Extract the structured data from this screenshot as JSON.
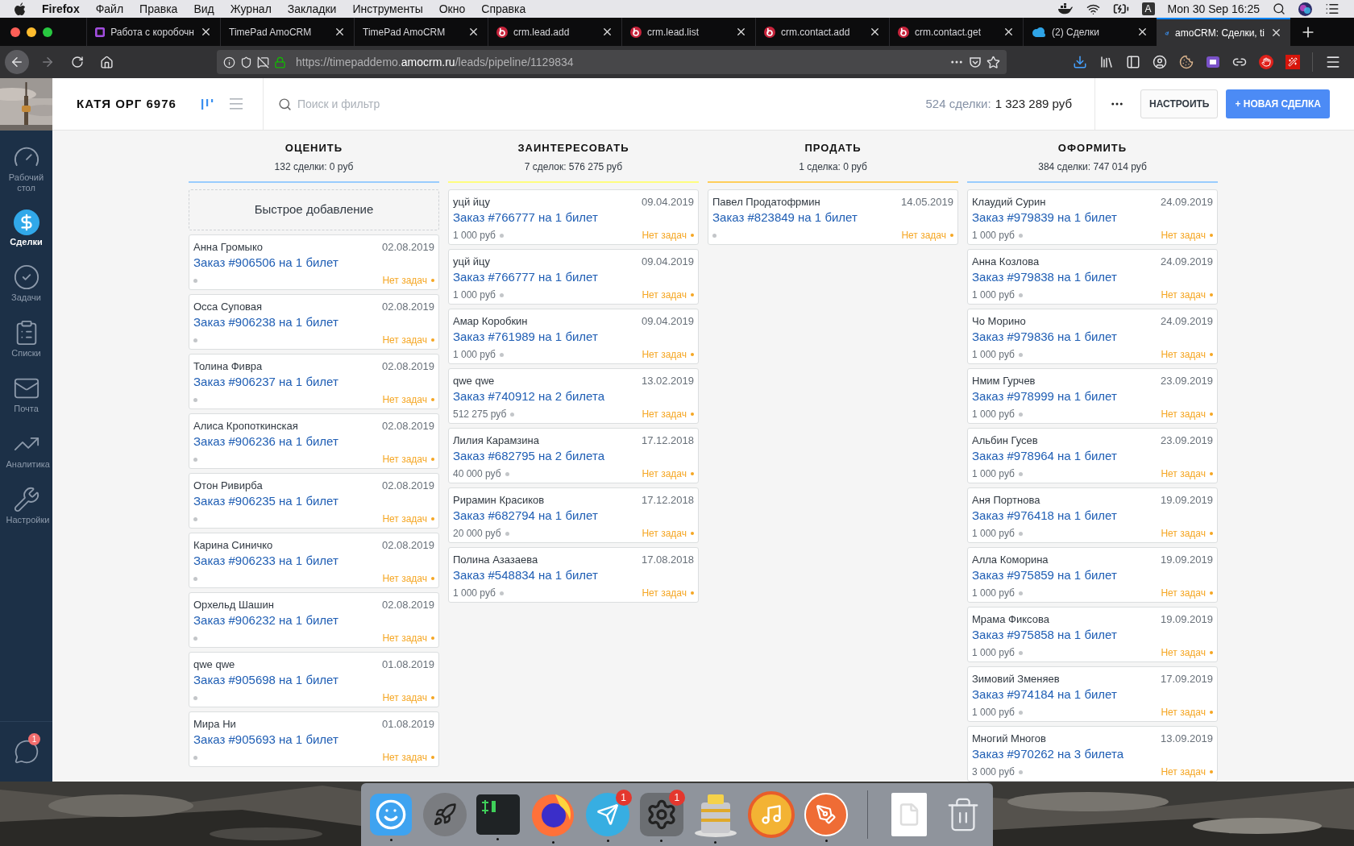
{
  "menu_bar": {
    "app": "Firefox",
    "items": [
      "Файл",
      "Правка",
      "Вид",
      "Журнал",
      "Закладки",
      "Инструменты",
      "Окно",
      "Справка"
    ],
    "input_source": "A",
    "clock": "Mon 30 Sep 16:25"
  },
  "tabs": [
    {
      "title": "Работа с коробочн",
      "kind": "youtrack",
      "selected": false
    },
    {
      "title": "TimePad AmoCRM",
      "kind": "plain",
      "selected": false
    },
    {
      "title": "TimePad AmoCRM",
      "kind": "plain",
      "selected": false
    },
    {
      "title": "crm.lead.add",
      "kind": "bitrix",
      "selected": false
    },
    {
      "title": "crm.lead.list",
      "kind": "bitrix",
      "selected": false
    },
    {
      "title": "crm.contact.add",
      "kind": "bitrix",
      "selected": false
    },
    {
      "title": "crm.contact.get",
      "kind": "bitrix",
      "selected": false
    },
    {
      "title": "(2) Сделки",
      "kind": "b24",
      "selected": false
    },
    {
      "title": "amoCRM: Сделки, ti",
      "kind": "amo",
      "selected": true
    }
  ],
  "address_bar": {
    "url": "https://timepaddemo.**amocrm.ru**/leads/pipeline/1129834"
  },
  "sidebar": {
    "items": [
      {
        "label": "Рабочий стол",
        "kind": "dashboard",
        "selected": false
      },
      {
        "label": "Сделки",
        "kind": "deals",
        "selected": true
      },
      {
        "label": "Задачи",
        "kind": "tasks",
        "selected": false
      },
      {
        "label": "Списки",
        "kind": "lists",
        "selected": false
      },
      {
        "label": "Почта",
        "kind": "mail",
        "selected": false
      },
      {
        "label": "Аналитика",
        "kind": "analytics",
        "selected": false
      },
      {
        "label": "Настройки",
        "kind": "settings",
        "selected": false
      }
    ],
    "chat_badge": "1"
  },
  "header": {
    "title": "КАТЯ ОРГ 6976",
    "views": [
      {
        "kind": "pipeline",
        "selected": true
      },
      {
        "kind": "list",
        "selected": false
      }
    ],
    "search": {
      "placeholder": "Поиск и фильтр"
    },
    "summary_count": "524 сделки:",
    "summary_total": "1 323 289 руб",
    "buttons": [
      {
        "label": "НАСТРОИТЬ",
        "kind": "secondary"
      },
      {
        "label": "+ НОВАЯ СДЕЛКА",
        "kind": "primary"
      }
    ]
  },
  "columns": [
    {
      "title": "ОЦЕНИТЬ",
      "summary": "132 сделки: 0 руб",
      "color": "#99ccfd",
      "quick_add": "Быстрое добавление",
      "cards": [
        {
          "contact": "Анна Громыко",
          "date": "02.08.2019",
          "title": "Заказ #906506 на 1 билет",
          "task": "Нет задач"
        },
        {
          "contact": "Осса Суповая",
          "date": "02.08.2019",
          "title": "Заказ #906238 на 1 билет",
          "task": "Нет задач"
        },
        {
          "contact": "Толина Фивра",
          "date": "02.08.2019",
          "title": "Заказ #906237 на 1 билет",
          "task": "Нет задач"
        },
        {
          "contact": "Алиса Кропоткинская",
          "date": "02.08.2019",
          "title": "Заказ #906236 на 1 билет",
          "task": "Нет задач"
        },
        {
          "contact": "Отон Ривирба",
          "date": "02.08.2019",
          "title": "Заказ #906235 на 1 билет",
          "task": "Нет задач"
        },
        {
          "contact": "Карина Синичко",
          "date": "02.08.2019",
          "title": "Заказ #906233 на 1 билет",
          "task": "Нет задач"
        },
        {
          "contact": "Орхельд Шашин",
          "date": "02.08.2019",
          "title": "Заказ #906232 на 1 билет",
          "task": "Нет задач"
        },
        {
          "contact": "qwe qwe",
          "date": "01.08.2019",
          "title": "Заказ #905698 на 1 билет",
          "task": "Нет задач"
        },
        {
          "contact": "Мира Ни",
          "date": "01.08.2019",
          "title": "Заказ #905693 на 1 билет",
          "task": "Нет задач"
        }
      ]
    },
    {
      "title": "ЗАИНТЕРЕСОВАТЬ",
      "summary": "7 сделок: 576 275 руб",
      "color": "#fffd7f",
      "cards": [
        {
          "contact": "уцй йцу",
          "date": "09.04.2019",
          "title": "Заказ #766777 на 1 билет",
          "price": "1 000 руб",
          "task": "Нет задач"
        },
        {
          "contact": "уцй йцу",
          "date": "09.04.2019",
          "title": "Заказ #766777 на 1 билет",
          "price": "1 000 руб",
          "task": "Нет задач"
        },
        {
          "contact": "Амар Коробкин",
          "date": "09.04.2019",
          "title": "Заказ #761989 на 1 билет",
          "price": "1 000 руб",
          "task": "Нет задач"
        },
        {
          "contact": "qwe qwe",
          "date": "13.02.2019",
          "title": "Заказ #740912 на 2 билета",
          "price": "512 275 руб",
          "task": "Нет задач"
        },
        {
          "contact": "Лилия Карамзина",
          "date": "17.12.2018",
          "title": "Заказ #682795 на 2 билета",
          "price": "40 000 руб",
          "task": "Нет задач"
        },
        {
          "contact": "Рирамин Красиков",
          "date": "17.12.2018",
          "title": "Заказ #682794 на 1 билет",
          "price": "20 000 руб",
          "task": "Нет задач"
        },
        {
          "contact": "Полина Азазаева",
          "date": "17.08.2018",
          "title": "Заказ #548834 на 1 билет",
          "price": "1 000 руб",
          "task": "Нет задач"
        }
      ]
    },
    {
      "title": "ПРОДАТЬ",
      "summary": "1 сделка: 0 руб",
      "color": "#ffce5a",
      "cards": [
        {
          "contact": "Павел Продатофрмин",
          "date": "14.05.2019",
          "title": "Заказ #823849 на 1 билет",
          "task": "Нет задач"
        }
      ]
    },
    {
      "title": "ОФОРМИТЬ",
      "summary": "384 сделки: 747 014 руб",
      "color": "#99ccfd",
      "cards": [
        {
          "contact": "Клаудий Сурин",
          "date": "24.09.2019",
          "title": "Заказ #979839 на 1 билет",
          "price": "1 000 руб",
          "task": "Нет задач"
        },
        {
          "contact": "Анна Козлова",
          "date": "24.09.2019",
          "title": "Заказ #979838 на 1 билет",
          "price": "1 000 руб",
          "task": "Нет задач"
        },
        {
          "contact": "Чо Морино",
          "date": "24.09.2019",
          "title": "Заказ #979836 на 1 билет",
          "price": "1 000 руб",
          "task": "Нет задач"
        },
        {
          "contact": "Нмим Гурчев",
          "date": "23.09.2019",
          "title": "Заказ #978999 на 1 билет",
          "price": "1 000 руб",
          "task": "Нет задач"
        },
        {
          "contact": "Альбин Гусев",
          "date": "23.09.2019",
          "title": "Заказ #978964 на 1 билет",
          "price": "1 000 руб",
          "task": "Нет задач"
        },
        {
          "contact": "Аня Портнова",
          "date": "19.09.2019",
          "title": "Заказ #976418 на 1 билет",
          "price": "1 000 руб",
          "task": "Нет задач"
        },
        {
          "contact": "Алла Коморина",
          "date": "19.09.2019",
          "title": "Заказ #975859 на 1 билет",
          "price": "1 000 руб",
          "task": "Нет задач"
        },
        {
          "contact": "Мрама Фиксова",
          "date": "19.09.2019",
          "title": "Заказ #975858 на 1 билет",
          "price": "1 000 руб",
          "task": "Нет задач"
        },
        {
          "contact": "Зимовий Зменяев",
          "date": "17.09.2019",
          "title": "Заказ #974184 на 1 билет",
          "price": "1 000 руб",
          "task": "Нет задач"
        },
        {
          "contact": "Многий Многов",
          "date": "13.09.2019",
          "title": "Заказ #970262 на 3 билета",
          "price": "3 000 руб",
          "task": "Нет задач"
        }
      ]
    }
  ],
  "dock": [
    {
      "kind": "finder",
      "running": true
    },
    {
      "kind": "launchpad",
      "running": false
    },
    {
      "kind": "terminal",
      "running": true
    },
    {
      "kind": "firefox",
      "running": true
    },
    {
      "kind": "telegram",
      "running": true,
      "badge": "1"
    },
    {
      "kind": "preferences",
      "running": true,
      "badge": "1"
    },
    {
      "kind": "database",
      "running": true
    },
    {
      "kind": "music",
      "running": false
    },
    {
      "kind": "postman",
      "running": true
    },
    {
      "kind": "separator"
    },
    {
      "kind": "document"
    },
    {
      "kind": "trash"
    }
  ]
}
